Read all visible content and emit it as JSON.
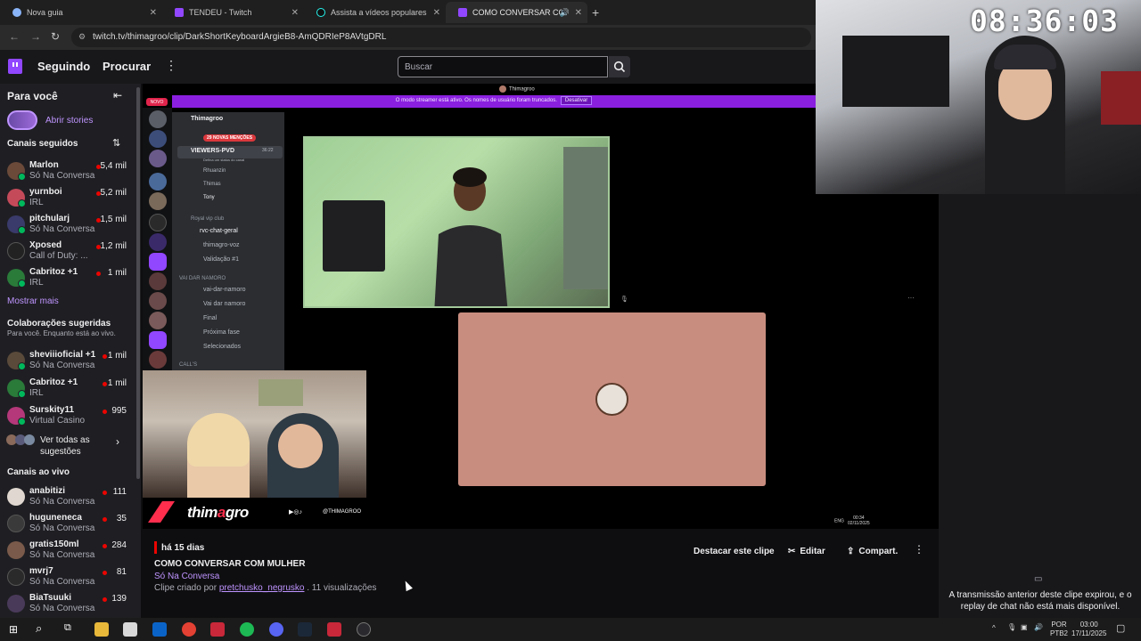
{
  "browser": {
    "tabs": [
      {
        "label": "Nova guia",
        "icon": "globe-icon"
      },
      {
        "label": "TENDEU - Twitch",
        "icon": "twitch-icon"
      },
      {
        "label": "Assista a vídeos populares para",
        "icon": "tiktok-icon"
      },
      {
        "label": "COMO CONVERSAR COM M",
        "icon": "twitch-icon"
      }
    ],
    "url": "twitch.tv/thimagroo/clip/DarkShortKeyboardArgieB8-AmQDRIeP8AVtgDRL"
  },
  "topnav": {
    "following": "Seguindo",
    "browse": "Procurar",
    "search_placeholder": "Buscar"
  },
  "sidebar": {
    "for_you": "Para você",
    "stories": "Abrir stories",
    "followed_header": "Canais seguidos",
    "followed": [
      {
        "name": "Marlon",
        "category": "Só Na Conversa",
        "viewers": "5,4 mil",
        "color": "#6b4a3a"
      },
      {
        "name": "yurnboi",
        "category": "IRL",
        "viewers": "5,2 mil",
        "color": "#c44a5a"
      },
      {
        "name": "pitchularj",
        "category": "Só Na Conversa",
        "viewers": "1,5 mil",
        "color": "#3a3a6b"
      },
      {
        "name": "Xposed",
        "category": "Call of Duty: ...",
        "viewers": "1,2 mil",
        "color": "#222222"
      },
      {
        "name": "Cabritoz +1",
        "category": "IRL",
        "viewers": "1 mil",
        "color": "#2a7a3a"
      }
    ],
    "show_more": "Mostrar mais",
    "collab_header": "Colaborações sugeridas",
    "collab_sub": "Para você. Enquanto está ao vivo.",
    "collabs": [
      {
        "name": "sheviiioficial +1",
        "category": "Só Na Conversa",
        "viewers": "1 mil",
        "color": "#5a4a3a"
      },
      {
        "name": "Cabritoz +1",
        "category": "IRL",
        "viewers": "1 mil",
        "color": "#2a7a3a"
      },
      {
        "name": "Surskity11",
        "category": "Virtual Casino",
        "viewers": "995",
        "color": "#b4387a"
      }
    ],
    "see_all": "Ver todas as sugestões",
    "live_header": "Canais ao vivo",
    "live": [
      {
        "name": "anabitizi",
        "category": "Só Na Conversa",
        "viewers": "111",
        "color": "#e0d8d0"
      },
      {
        "name": "huguneneca",
        "category": "Só Na Conversa",
        "viewers": "35",
        "color": "#3a3a3a"
      },
      {
        "name": "gratis150ml",
        "category": "Só Na Conversa",
        "viewers": "284",
        "color": "#7a5a4a"
      },
      {
        "name": "mvrj7",
        "category": "Só Na Conversa",
        "viewers": "81",
        "color": "#2a2a2a"
      },
      {
        "name": "BiaTsuuki",
        "category": "Só Na Conversa",
        "viewers": "139",
        "color": "#4a3a5a"
      }
    ]
  },
  "video": {
    "discord_user": "Thimagroo",
    "streamer_banner": "O modo streamer está ativo. Os nomes de usuário foram truncados.",
    "streamer_disable": "Desativar",
    "server_name": "Thimagroo",
    "mentions": "29 NOVAS MENÇÕES",
    "voice_channel": "VIEWERS-PVD",
    "voice_sub": "Defina um status do canal",
    "voice_time": "36:22",
    "members": [
      "Rhuanzin",
      "Thimas",
      "Tony"
    ],
    "royal_cat": "Royal vip club",
    "royal_channels": [
      "rvc-chat-geral",
      "thimagro-voz",
      "Validação #1"
    ],
    "namoro_cat": "VAI DAR NAMORO",
    "namoro_channels": [
      "vai-dar-namoro",
      "Vai dar namoro",
      "Final",
      "Próxima fase",
      "Selecionados"
    ],
    "calls_cat": "CALL'S",
    "overlay_name_a": "thim",
    "overlay_name_b": "a",
    "overlay_name_c": "gro",
    "overlay_handle": "@THIMAGROO",
    "tray_lang": "ENG",
    "tray_time": "00:34",
    "tray_date": "02/11/2025"
  },
  "clip": {
    "age": "há 15 dias",
    "title": "COMO CONVERSAR COM MULHER",
    "category": "Só Na Conversa",
    "created_by_prefix": "Clipe criado por",
    "creator": "pretchusko_negrusko",
    "views": ". 11 visualizações",
    "feature_btn": "Destacar este clipe",
    "edit_btn": "Editar",
    "share_btn": "Compart."
  },
  "overlay": {
    "clock": "08:36:03"
  },
  "chat": {
    "message": "A transmissão anterior deste clipe expirou, e o replay de chat não está mais disponível."
  },
  "taskbar": {
    "lang": "POR",
    "lang_sub": "PTB2",
    "time": "03:00",
    "date": "17/11/2025"
  },
  "colors": {
    "twitch_purple": "#9147ff",
    "live_red": "#eb0400",
    "link_purple": "#bf94ff"
  }
}
